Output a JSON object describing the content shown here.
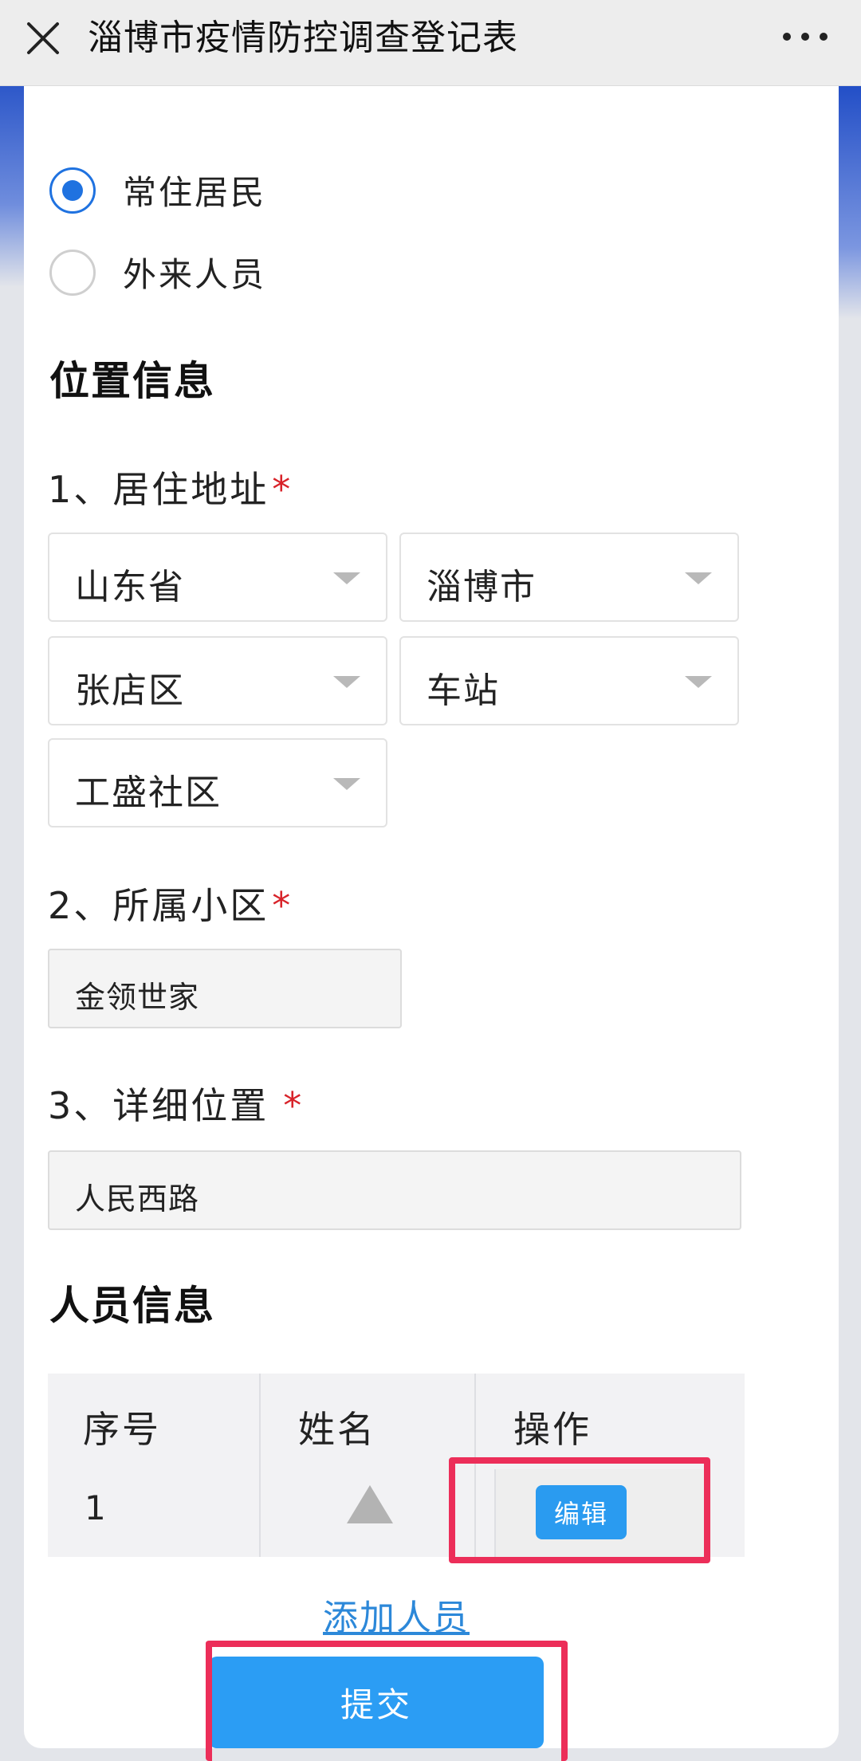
{
  "header": {
    "title": "淄博市疫情防控调查登记表",
    "close_icon": "close-icon",
    "more_icon": "more-icon"
  },
  "resident_type": {
    "options": [
      {
        "label": "常住居民",
        "checked": true
      },
      {
        "label": "外来人员",
        "checked": false
      }
    ]
  },
  "location": {
    "section_title": "位置信息",
    "address": {
      "label": "1、居住地址",
      "required_mark": "*",
      "province": "山东省",
      "city": "淄博市",
      "district": "张店区",
      "street": "车站",
      "community": "工盛社区"
    },
    "estate": {
      "label": "2、所属小区",
      "required_mark": "*",
      "value": "金领世家"
    },
    "detail": {
      "label": "3、详细位置",
      "required_mark": "*",
      "value": "人民西路"
    }
  },
  "people": {
    "section_title": "人员信息",
    "columns": [
      "序号",
      "姓名",
      "操作"
    ],
    "rows": [
      {
        "index": "1",
        "name_icon": "triangle-placeholder-icon",
        "action": "编辑"
      }
    ],
    "add_label": "添加人员"
  },
  "submit_label": "提交",
  "colors": {
    "primary": "#2b9df4",
    "radio_active": "#1f72e0",
    "required": "#d8232a",
    "highlight": "#ec2e59",
    "link": "#2c88d9"
  }
}
